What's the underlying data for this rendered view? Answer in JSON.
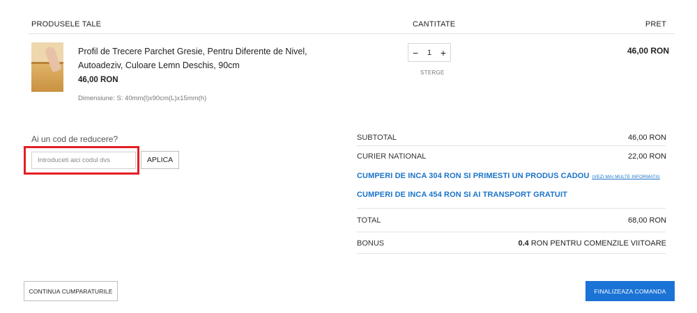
{
  "table_header": {
    "products": "PRODUSELE TALE",
    "quantity": "CANTITATE",
    "price": "PRET"
  },
  "cart_item": {
    "title": "Profil de Trecere Parchet Gresie, Pentru Diferente de Nivel, Autoadeziv, Culoare Lemn Deschis, 90cm",
    "unit_price": "46,00 RON",
    "dimensions": "Dimensiune: S: 40mm(l)x90cm(L)x15mm(h)",
    "quantity": "1",
    "minus_label": "−",
    "plus_label": "+",
    "remove_label": "STERGE",
    "row_total": "46,00 RON",
    "thumbnail_icon": "product-photo"
  },
  "coupon": {
    "question": "Ai un cod de reducere?",
    "placeholder": "Introduceti aici codul dvs",
    "value": "",
    "apply_label": "APLICA"
  },
  "summary": {
    "subtotal_label": "SUBTOTAL",
    "subtotal_value": "46,00 RON",
    "shipping_label": "CURIER NATIONAL",
    "shipping_value": "22,00 RON",
    "promo_gift": "CUMPERI DE INCA 304 RON SI PRIMESTI UN PRODUS CADOU",
    "promo_gift_link": "(VEZI MAI MULTE INFORMATII)",
    "promo_shipping": "CUMPERI DE INCA 454 RON SI AI TRANSPORT GRATUIT",
    "total_label": "TOTAL",
    "total_value": "68,00 RON",
    "bonus_label": "BONUS",
    "bonus_amount": "0.4",
    "bonus_suffix": " RON PENTRU COMENZILE VIITOARE"
  },
  "actions": {
    "continue_label": "CONTINUA CUMPARATURILE",
    "finalize_label": "FINALIZEAZA COMANDA"
  },
  "colors": {
    "accent": "#1b73d6",
    "promo_text": "#1a73c8",
    "highlight": "#e31e24"
  }
}
